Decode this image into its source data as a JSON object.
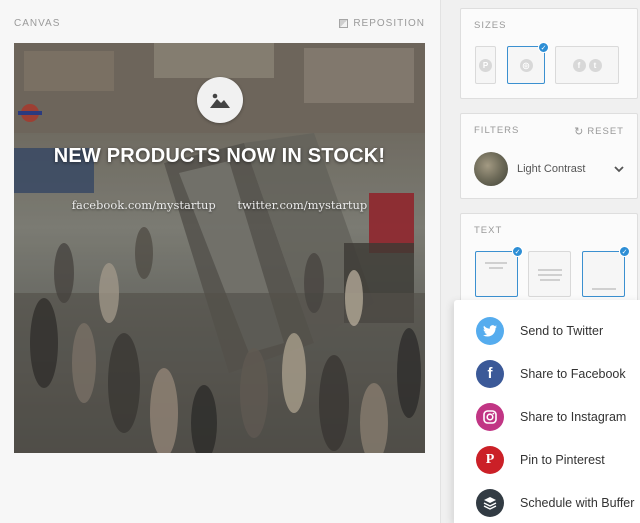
{
  "canvas": {
    "label": "CANVAS",
    "reposition_label": "REPOSITION",
    "headline": "NEW PRODUCTS NOW IN STOCK!",
    "facebook_handle": "facebook.com/mystartup",
    "twitter_handle": "twitter.com/mystartup"
  },
  "sizes": {
    "title": "SIZES",
    "options": [
      {
        "icon": "pinterest-icon",
        "selected": false
      },
      {
        "icon": "instagram-icon",
        "selected": true
      },
      {
        "icon": "facebook-twitter-icons",
        "selected": false
      }
    ]
  },
  "filters": {
    "title": "FILTERS",
    "reset_label": "RESET",
    "selected_filter": "Light Contrast"
  },
  "text": {
    "title": "TEXT",
    "options": [
      {
        "layout": "top",
        "selected": true
      },
      {
        "layout": "middle",
        "selected": false
      },
      {
        "layout": "bottom",
        "selected": true
      }
    ]
  },
  "share_menu": {
    "items": [
      {
        "label": "Send to Twitter",
        "icon": "twitter-icon",
        "color": "#55acee"
      },
      {
        "label": "Share to Facebook",
        "icon": "facebook-icon",
        "color": "#3b5998"
      },
      {
        "label": "Share to Instagram",
        "icon": "instagram-icon",
        "color": "#c13584"
      },
      {
        "label": "Pin to Pinterest",
        "icon": "pinterest-icon",
        "color": "#cb2027"
      },
      {
        "label": "Schedule with Buffer",
        "icon": "buffer-icon",
        "color": "#323b43"
      }
    ]
  },
  "colors": {
    "accent": "#2d8ed5"
  }
}
